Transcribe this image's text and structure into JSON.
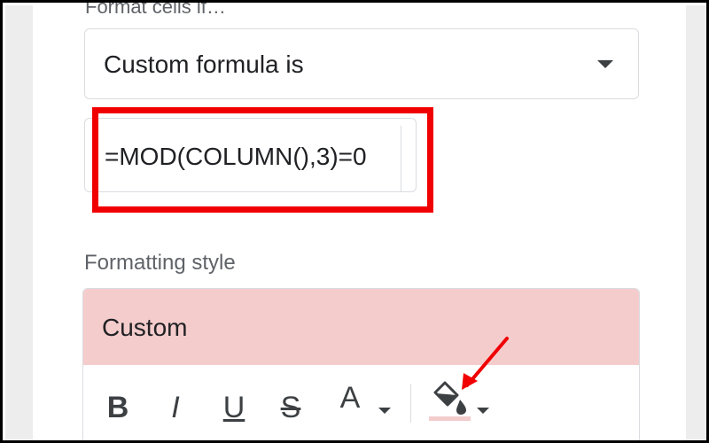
{
  "format_cells_if": {
    "label_partial": "Format cells if…",
    "condition": "Custom formula is",
    "formula": "=MOD(COLUMN(),3)=0"
  },
  "formatting_style": {
    "label": "Formatting style",
    "preset": "Custom",
    "preview_fill_color": "#f4cccc",
    "toolbar": {
      "bold_icon": "B",
      "italic_icon": "I",
      "underline_icon": "U",
      "strikethrough_icon": "S",
      "text_color_icon": "A"
    }
  },
  "colors": {
    "highlight_box": "#f00000",
    "annotation_arrow": "#f00000",
    "fill_color_swatch": "#f4cccc"
  },
  "icons": {
    "dropdown_caret": "chevron-down-icon",
    "bold": "bold-icon",
    "italic": "italic-icon",
    "underline": "underline-icon",
    "strikethrough": "strikethrough-icon",
    "text_color": "text-color-icon",
    "fill_color": "paint-bucket-icon",
    "annotation": "arrow-icon"
  }
}
